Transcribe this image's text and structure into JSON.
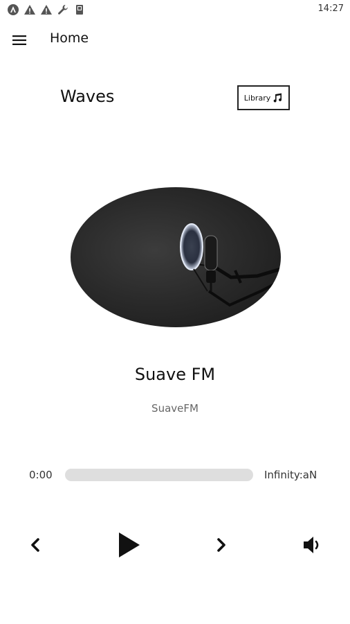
{
  "status_bar": {
    "time": "14:27",
    "icons": [
      "app-notification-icon",
      "warning-icon",
      "warning-icon",
      "wrench-icon",
      "storage-icon"
    ]
  },
  "app_bar": {
    "title": "Home",
    "menu_icon": "hamburger-menu-icon"
  },
  "header": {
    "brand": "Waves",
    "library_label": "Library",
    "library_icon": "music-note-icon"
  },
  "player": {
    "artwork_icon": "microphone-artwork",
    "track_title": "Suave FM",
    "track_artist": "SuaveFM",
    "current_time": "0:00",
    "total_time": "Infinity:aN",
    "progress": 0,
    "controls": [
      "previous-icon",
      "play-icon",
      "next-icon",
      "volume-icon"
    ]
  },
  "colors": {
    "background": "#ffffff",
    "text": "#111111",
    "muted_text": "#666666",
    "progress_track": "#dedede"
  }
}
